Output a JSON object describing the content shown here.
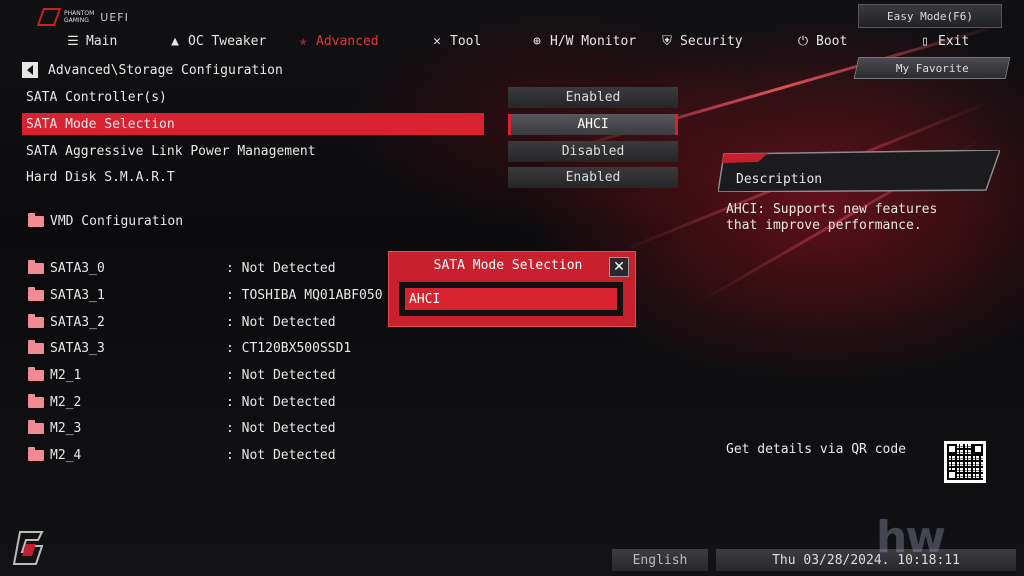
{
  "app": {
    "brand_line1": "PHANTOM",
    "brand_line2": "GAMING",
    "brand_suffix": "UEFI"
  },
  "header": {
    "easy_mode": "Easy Mode(F6)",
    "my_favorite": "My Favorite",
    "nav": [
      {
        "label": "Main",
        "icon": "list-icon"
      },
      {
        "label": "OC Tweaker",
        "icon": "rocket-icon"
      },
      {
        "label": "Advanced",
        "icon": "star-icon",
        "active": true
      },
      {
        "label": "Tool",
        "icon": "wrench-icon"
      },
      {
        "label": "H/W Monitor",
        "icon": "target-icon"
      },
      {
        "label": "Security",
        "icon": "shield-icon"
      },
      {
        "label": "Boot",
        "icon": "power-icon"
      },
      {
        "label": "Exit",
        "icon": "exit-door-icon"
      }
    ]
  },
  "breadcrumb": "Advanced\\Storage Configuration",
  "settings": [
    {
      "label": "SATA Controller(s)",
      "value": "Enabled"
    },
    {
      "label": "SATA Mode Selection",
      "value": "AHCI",
      "selected": true
    },
    {
      "label": "SATA Aggressive Link Power Management",
      "value": "Disabled"
    },
    {
      "label": "Hard Disk S.M.A.R.T",
      "value": "Enabled"
    }
  ],
  "submenu": {
    "label": "VMD Configuration"
  },
  "devices": [
    {
      "label": "SATA3_0",
      "value": ": Not Detected"
    },
    {
      "label": "SATA3_1",
      "value": ": TOSHIBA MQ01ABF050"
    },
    {
      "label": "SATA3_2",
      "value": ": Not Detected"
    },
    {
      "label": "SATA3_3",
      "value": ": CT120BX500SSD1"
    },
    {
      "label": "M2_1",
      "value": ": Not Detected"
    },
    {
      "label": "M2_2",
      "value": ": Not Detected"
    },
    {
      "label": "M2_3",
      "value": ": Not Detected"
    },
    {
      "label": "M2_4",
      "value": ": Not Detected"
    }
  ],
  "popup": {
    "title": "SATA Mode Selection",
    "option": "AHCI"
  },
  "description": {
    "title": "Description",
    "text": "AHCI: Supports new features that improve performance."
  },
  "qr": {
    "label": "Get details via QR code"
  },
  "footer": {
    "language": "English",
    "datetime": "Thu 03/28/2024. 10:18:11"
  },
  "watermark": "hw",
  "colors": {
    "accent": "#d8222f",
    "background": "#0b0b0d"
  }
}
